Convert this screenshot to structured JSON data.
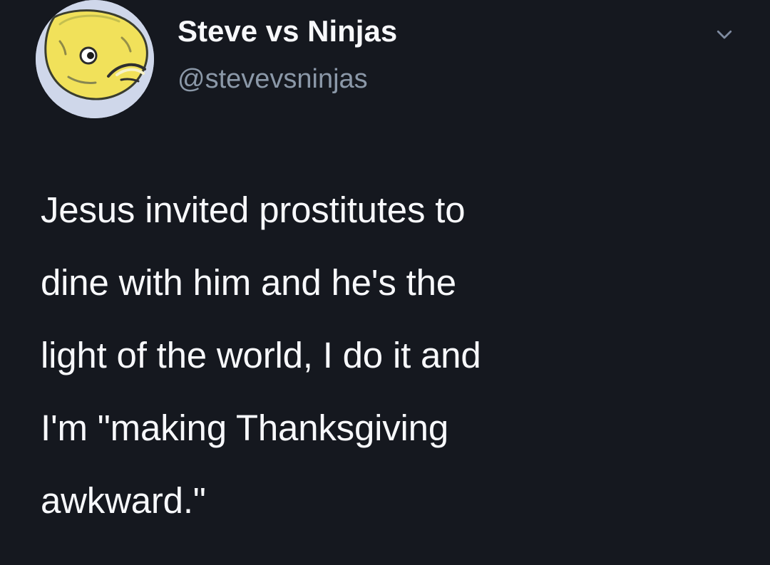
{
  "tweet": {
    "author": {
      "display_name": "Steve vs Ninjas",
      "handle": "@stevevsninjas",
      "avatar_icon": "fish-cartoon-avatar"
    },
    "menu_icon": "chevron-down-icon",
    "text": "Jesus invited prostitutes to\ndine with him and he's the\nlight of the world, I do it and\nI'm \"making Thanksgiving\nawkward.\""
  },
  "colors": {
    "background": "#15181f",
    "primary_text": "#f7f8fb",
    "secondary_text": "#8b98a8",
    "avatar_bg": "#cfd7ea"
  }
}
